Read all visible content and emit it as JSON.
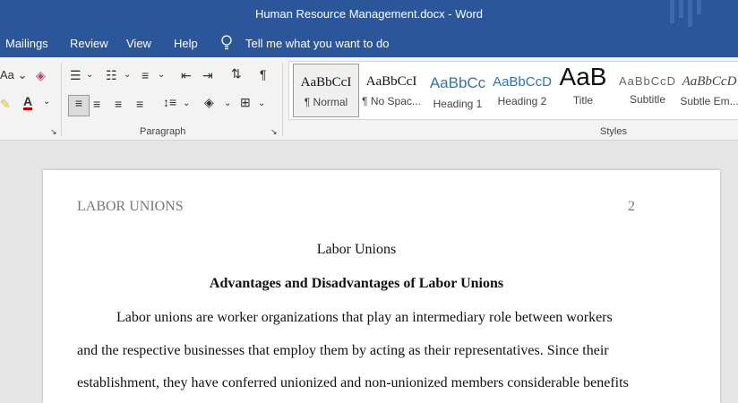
{
  "window": {
    "title": "Human Resource Management.docx  -  Word"
  },
  "menu": [
    "Mailings",
    "Review",
    "View",
    "Help"
  ],
  "tell_me": "Tell me what you want to do",
  "ribbon": {
    "font_partial": "Aa",
    "paragraph_group_label": "Paragraph",
    "styles_group_label": "Styles",
    "styles": [
      {
        "sample": "AaBbCcI",
        "name": "¶ Normal"
      },
      {
        "sample": "AaBbCcI",
        "name": "¶ No Spac..."
      },
      {
        "sample": "AaBbCc",
        "name": "Heading 1"
      },
      {
        "sample": "AaBbCcD",
        "name": "Heading 2"
      },
      {
        "sample": "AaB",
        "name": "Title"
      },
      {
        "sample": "AaBbCcD",
        "name": "Subtitle"
      },
      {
        "sample": "AaBbCcD",
        "name": "Subtle Em..."
      }
    ]
  },
  "document": {
    "header_left": "LABOR UNIONS",
    "page_number": "2",
    "title": "Labor Unions",
    "heading": "Advantages and Disadvantages of Labor Unions",
    "lines": [
      "Labor unions are worker organizations that play an intermediary role between workers",
      "and the respective businesses that employ them by acting as their representatives. Since their",
      "establishment, they have conferred unionized and non-unionized members considerable benefits"
    ]
  },
  "colors": {
    "brand": "#2b579a",
    "ribbon": "#f3f3f3",
    "canvas": "#e6e6e6"
  }
}
